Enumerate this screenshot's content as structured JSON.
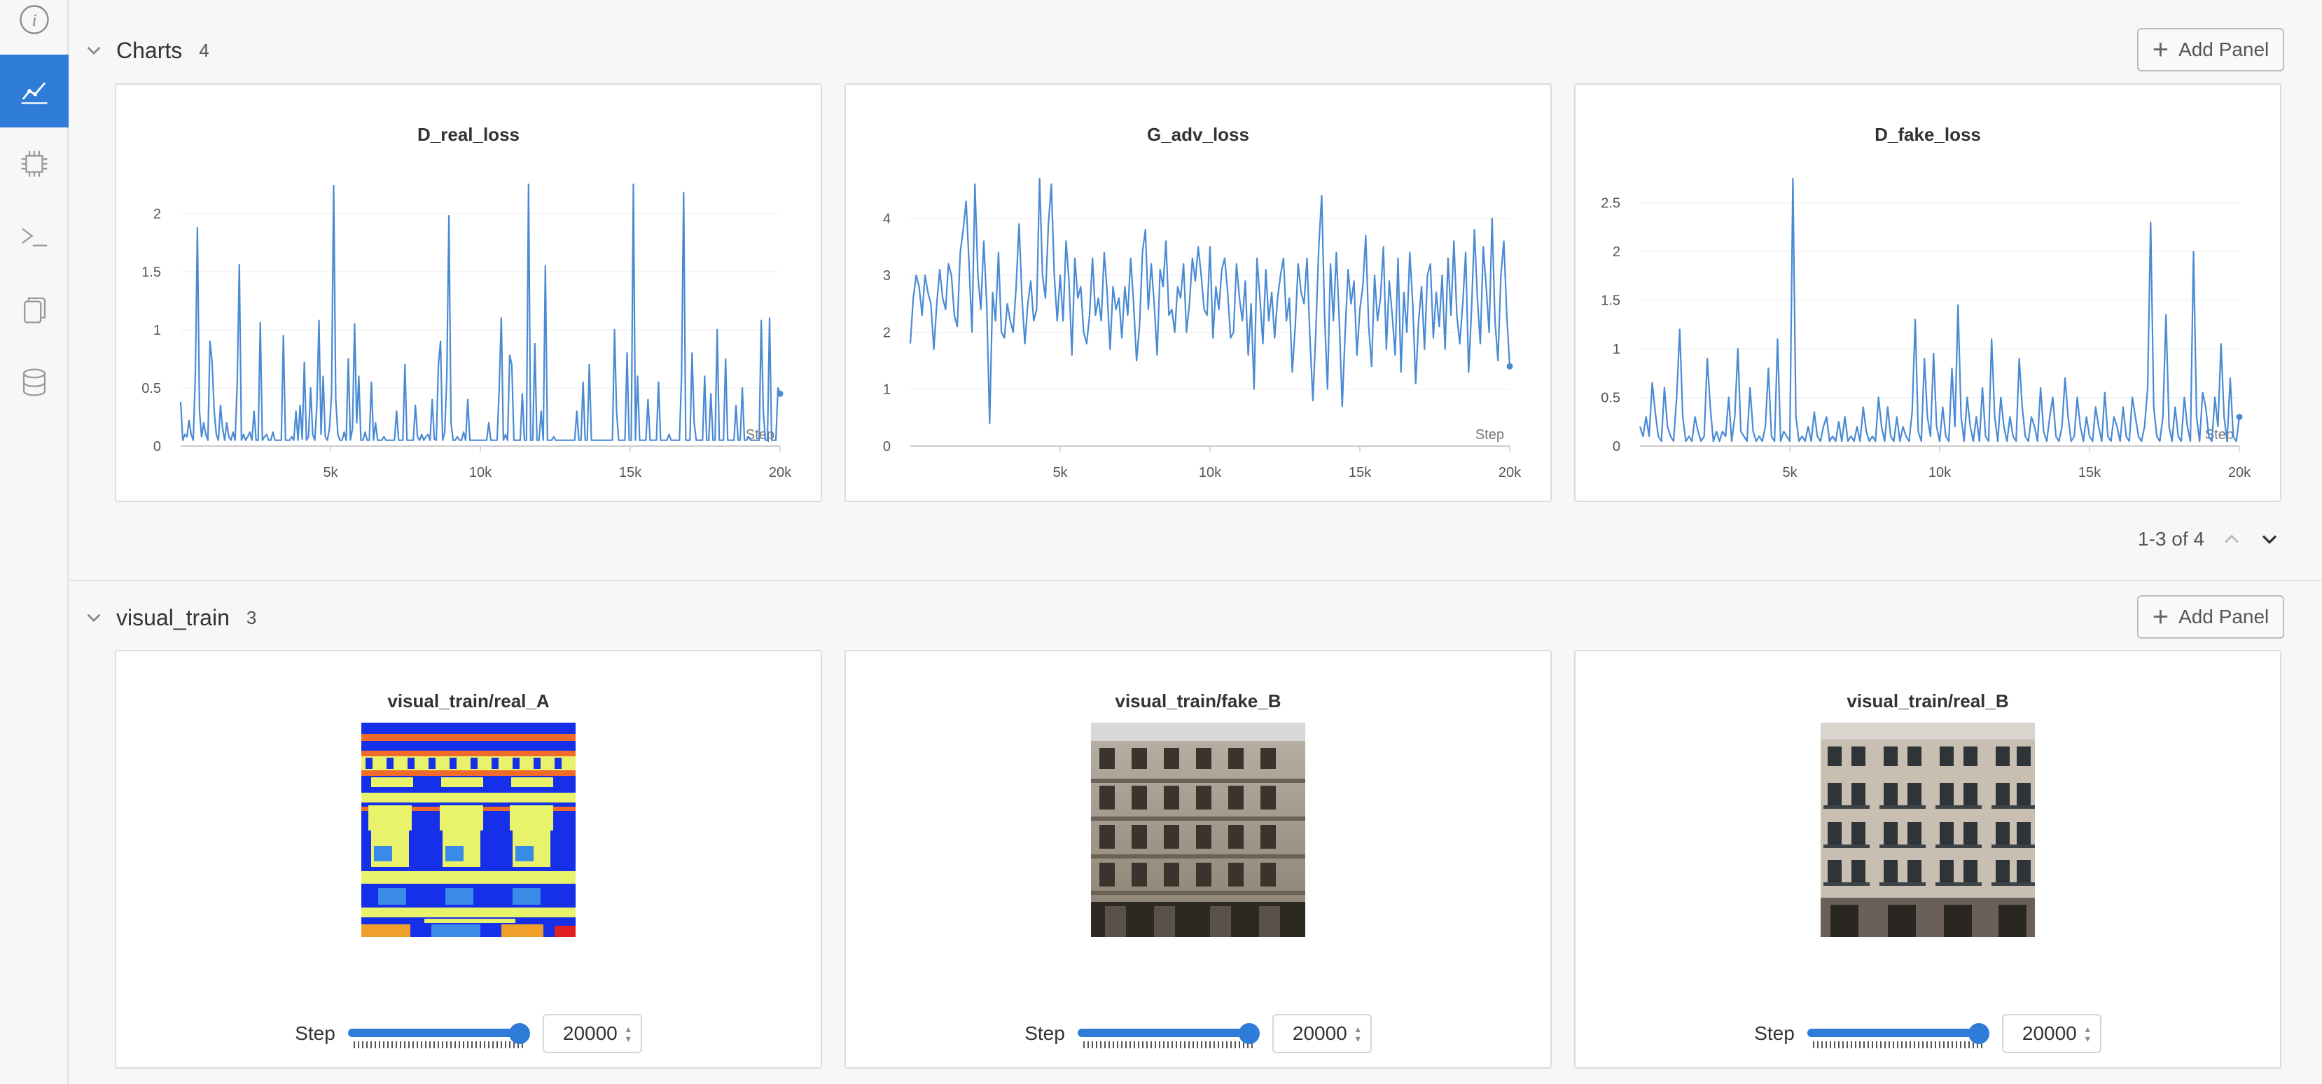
{
  "sidebar": {
    "items": [
      {
        "icon": "info-icon"
      },
      {
        "icon": "chart-icon",
        "active": true
      },
      {
        "icon": "cpu-icon"
      },
      {
        "icon": "terminal-icon"
      },
      {
        "icon": "files-icon"
      },
      {
        "icon": "database-icon"
      }
    ]
  },
  "charts_section": {
    "title": "Charts",
    "count": "4",
    "add_panel_label": "Add Panel",
    "pager_text": "1-3 of 4"
  },
  "visual_section": {
    "title": "visual_train",
    "count": "3",
    "add_panel_label": "Add Panel"
  },
  "colors": {
    "accent": "#2e7bd8",
    "line": "#4a8ad4"
  },
  "chart_data": [
    {
      "type": "line",
      "title": "D_real_loss",
      "xlabel": "Step",
      "xlim": [
        0,
        20000
      ],
      "ylim": [
        0,
        2.3
      ],
      "xticks": [
        "5k",
        "10k",
        "15k",
        "20k"
      ],
      "xtick_values": [
        5000,
        10000,
        15000,
        20000
      ],
      "yticks": [
        "0",
        "0.5",
        "1",
        "1.5",
        "2"
      ],
      "ytick_values": [
        0,
        0.5,
        1,
        1.5,
        2
      ],
      "series": [
        {
          "values": [
            0.38,
            0.05,
            0.1,
            0.08,
            0.22,
            0.1,
            0.05,
            0.62,
            1.88,
            0.3,
            0.08,
            0.2,
            0.1,
            0.05,
            0.9,
            0.72,
            0.3,
            0.1,
            0.05,
            0.35,
            0.15,
            0.05,
            0.2,
            0.08,
            0.05,
            0.12,
            0.05,
            0.55,
            1.56,
            0.05,
            0.1,
            0.05,
            0.08,
            0.12,
            0.05,
            0.3,
            0.05,
            0.05,
            1.06,
            0.05,
            0.08,
            0.1,
            0.05,
            0.05,
            0.12,
            0.05,
            0.05,
            0.05,
            0.05,
            0.95,
            0.05,
            0.05,
            0.05,
            0.08,
            0.05,
            0.3,
            0.05,
            0.35,
            0.06,
            0.72,
            0.05,
            0.08,
            0.5,
            0.1,
            0.05,
            0.35,
            1.08,
            0.1,
            0.6,
            0.08,
            0.05,
            0.15,
            0.45,
            2.24,
            0.4,
            0.1,
            0.05,
            0.05,
            0.12,
            0.05,
            0.75,
            0.05,
            0.15,
            1.05,
            0.2,
            0.6,
            0.05,
            0.05,
            0.12,
            0.05,
            0.05,
            0.55,
            0.05,
            0.2,
            0.05,
            0.05,
            0.05,
            0.08,
            0.05,
            0.05,
            0.05,
            0.05,
            0.05,
            0.3,
            0.05,
            0.05,
            0.05,
            0.7,
            0.05,
            0.05,
            0.05,
            0.05,
            0.35,
            0.08,
            0.05,
            0.1,
            0.05,
            0.08,
            0.1,
            0.05,
            0.4,
            0.06,
            0.05,
            0.7,
            0.9,
            0.05,
            0.12,
            0.6,
            1.98,
            0.2,
            0.05,
            0.05,
            0.08,
            0.05,
            0.05,
            0.12,
            0.05,
            0.4,
            0.05,
            0.05,
            0.05,
            0.05,
            0.05,
            0.05,
            0.05,
            0.05,
            0.05,
            0.2,
            0.05,
            0.05,
            0.05,
            0.05,
            0.5,
            1.1,
            0.05,
            0.1,
            0.05,
            0.78,
            0.7,
            0.05,
            0.05,
            0.05,
            0.05,
            0.45,
            0.05,
            0.05,
            2.25,
            0.05,
            0.05,
            0.88,
            0.05,
            0.05,
            0.3,
            0.05,
            1.55,
            0.05,
            0.05,
            0.05,
            0.08,
            0.05,
            0.05,
            0.05,
            0.05,
            0.05,
            0.05,
            0.05,
            0.05,
            0.05,
            0.05,
            0.3,
            0.05,
            0.05,
            0.55,
            0.05,
            0.05,
            0.7,
            0.05,
            0.05,
            0.05,
            0.05,
            0.05,
            0.05,
            0.05,
            0.05,
            0.05,
            0.05,
            0.05,
            1.0,
            0.3,
            0.05,
            0.05,
            0.05,
            0.05,
            0.8,
            0.05,
            0.05,
            2.25,
            0.05,
            0.6,
            0.05,
            0.05,
            0.05,
            0.05,
            0.4,
            0.05,
            0.05,
            0.05,
            0.05,
            0.55,
            0.05,
            0.05,
            0.05,
            0.05,
            0.1,
            0.05,
            0.05,
            0.05,
            0.05,
            0.05,
            0.6,
            2.18,
            0.05,
            0.05,
            0.05,
            0.8,
            0.2,
            0.05,
            0.05,
            0.05,
            0.05,
            0.6,
            0.05,
            0.05,
            0.45,
            0.05,
            0.05,
            1.0,
            0.05,
            0.05,
            0.05,
            0.75,
            0.05,
            0.05,
            0.05,
            0.05,
            0.35,
            0.05,
            0.05,
            0.5,
            0.05,
            0.05,
            0.08,
            0.05,
            0.05,
            0.05,
            0.05,
            0.05,
            1.08,
            0.3,
            0.05,
            0.05,
            1.1,
            0.05,
            0.05,
            0.05,
            0.5,
            0.45
          ]
        }
      ]
    },
    {
      "type": "line",
      "title": "G_adv_loss",
      "xlabel": "Step",
      "xlim": [
        0,
        20000
      ],
      "ylim": [
        0,
        4.7
      ],
      "xticks": [
        "5k",
        "10k",
        "15k",
        "20k"
      ],
      "xtick_values": [
        5000,
        10000,
        15000,
        20000
      ],
      "yticks": [
        "0",
        "1",
        "2",
        "3",
        "4"
      ],
      "ytick_values": [
        0,
        1,
        2,
        3,
        4
      ],
      "series": [
        {
          "values": [
            1.8,
            2.6,
            3.0,
            2.8,
            2.3,
            3.0,
            2.7,
            2.5,
            1.7,
            2.5,
            3.1,
            2.6,
            2.4,
            3.2,
            3.0,
            2.3,
            2.1,
            3.4,
            3.8,
            4.3,
            3.2,
            2.0,
            4.6,
            3.0,
            2.4,
            3.6,
            2.5,
            0.4,
            2.7,
            2.2,
            3.4,
            2.0,
            1.9,
            2.5,
            2.2,
            2.0,
            2.8,
            3.9,
            2.6,
            1.8,
            2.5,
            2.9,
            2.2,
            2.4,
            4.7,
            3.0,
            2.6,
            3.9,
            4.6,
            3.0,
            2.2,
            3.0,
            2.2,
            3.6,
            2.9,
            1.6,
            3.3,
            2.6,
            2.8,
            2.0,
            1.8,
            2.3,
            3.3,
            2.3,
            2.6,
            2.2,
            3.4,
            2.7,
            1.7,
            2.8,
            2.4,
            2.6,
            1.9,
            2.8,
            2.3,
            3.3,
            2.5,
            1.5,
            2.1,
            3.4,
            3.8,
            2.4,
            3.2,
            2.5,
            1.6,
            3.1,
            2.8,
            3.6,
            2.3,
            2.4,
            2.0,
            2.8,
            2.6,
            3.2,
            2.0,
            2.5,
            3.3,
            2.9,
            3.5,
            3.0,
            2.4,
            2.3,
            3.5,
            1.9,
            2.8,
            2.4,
            3.1,
            3.3,
            2.7,
            1.9,
            2.0,
            3.2,
            2.6,
            2.2,
            2.9,
            1.6,
            2.5,
            1.0,
            3.3,
            2.6,
            1.8,
            3.1,
            2.2,
            2.7,
            1.9,
            2.6,
            3.0,
            3.3,
            2.2,
            2.6,
            1.3,
            2.1,
            3.2,
            2.7,
            2.5,
            3.3,
            1.9,
            0.8,
            2.0,
            3.5,
            4.4,
            2.3,
            1.0,
            3.2,
            2.2,
            3.4,
            2.2,
            0.7,
            2.0,
            3.1,
            2.5,
            2.9,
            1.6,
            2.4,
            2.8,
            3.7,
            2.1,
            1.4,
            3.0,
            2.2,
            2.6,
            3.5,
            1.7,
            2.9,
            2.3,
            1.6,
            3.3,
            1.3,
            2.7,
            2.0,
            3.4,
            2.5,
            1.1,
            2.2,
            2.8,
            1.7,
            3.0,
            3.2,
            1.9,
            2.7,
            2.1,
            3.0,
            1.7,
            3.3,
            2.3,
            3.6,
            2.3,
            1.8,
            2.5,
            3.4,
            1.3,
            2.4,
            3.8,
            2.6,
            1.8,
            3.5,
            2.8,
            2.0,
            4.0,
            2.2,
            1.5,
            3.0,
            3.6,
            2.3,
            1.4
          ]
        }
      ]
    },
    {
      "type": "line",
      "title": "D_fake_loss",
      "xlabel": "Step",
      "xlim": [
        0,
        20000
      ],
      "ylim": [
        0,
        2.75
      ],
      "xticks": [
        "5k",
        "10k",
        "15k",
        "20k"
      ],
      "xtick_values": [
        5000,
        10000,
        15000,
        20000
      ],
      "yticks": [
        "0",
        "0.5",
        "1",
        "1.5",
        "2",
        "2.5"
      ],
      "ytick_values": [
        0,
        0.5,
        1,
        1.5,
        2,
        2.5
      ],
      "series": [
        {
          "values": [
            0.2,
            0.1,
            0.3,
            0.1,
            0.65,
            0.35,
            0.1,
            0.05,
            0.6,
            0.2,
            0.1,
            0.05,
            0.5,
            1.2,
            0.3,
            0.05,
            0.1,
            0.05,
            0.3,
            0.15,
            0.05,
            0.1,
            0.9,
            0.4,
            0.05,
            0.15,
            0.05,
            0.15,
            0.1,
            0.5,
            0.05,
            0.3,
            1.0,
            0.15,
            0.1,
            0.05,
            0.6,
            0.15,
            0.05,
            0.1,
            0.05,
            0.2,
            0.8,
            0.1,
            0.05,
            1.1,
            0.05,
            0.15,
            0.1,
            0.05,
            2.75,
            0.3,
            0.05,
            0.1,
            0.05,
            0.2,
            0.05,
            0.35,
            0.1,
            0.05,
            0.2,
            0.3,
            0.05,
            0.1,
            0.05,
            0.25,
            0.05,
            0.3,
            0.05,
            0.1,
            0.05,
            0.2,
            0.05,
            0.4,
            0.15,
            0.05,
            0.1,
            0.05,
            0.5,
            0.2,
            0.05,
            0.4,
            0.1,
            0.05,
            0.3,
            0.05,
            0.2,
            0.1,
            0.05,
            0.35,
            1.3,
            0.15,
            0.05,
            0.9,
            0.3,
            0.1,
            0.95,
            0.2,
            0.05,
            0.4,
            0.1,
            0.05,
            0.8,
            0.2,
            1.45,
            0.3,
            0.05,
            0.5,
            0.2,
            0.05,
            0.3,
            0.05,
            0.6,
            0.1,
            0.05,
            1.1,
            0.3,
            0.05,
            0.5,
            0.2,
            0.05,
            0.3,
            0.1,
            0.05,
            0.9,
            0.4,
            0.1,
            0.05,
            0.3,
            0.2,
            0.05,
            0.6,
            0.15,
            0.05,
            0.3,
            0.5,
            0.1,
            0.05,
            0.2,
            0.7,
            0.3,
            0.05,
            0.1,
            0.5,
            0.2,
            0.05,
            0.3,
            0.1,
            0.05,
            0.4,
            0.2,
            0.05,
            0.55,
            0.1,
            0.05,
            0.3,
            0.2,
            0.05,
            0.4,
            0.1,
            0.05,
            0.5,
            0.3,
            0.1,
            0.05,
            0.2,
            0.6,
            2.3,
            0.4,
            0.1,
            0.05,
            0.3,
            1.35,
            0.2,
            0.05,
            0.4,
            0.1,
            0.05,
            0.5,
            0.2,
            0.05,
            2.0,
            0.3,
            0.05,
            0.55,
            0.4,
            0.1,
            0.05,
            0.5,
            0.2,
            1.05,
            0.3,
            0.05,
            0.7,
            0.1,
            0.05,
            0.3
          ]
        }
      ]
    }
  ],
  "visual_panels": [
    {
      "title": "visual_train/real_A",
      "image": "segmentation-label-map",
      "step_label": "Step",
      "step_value": "20000"
    },
    {
      "title": "visual_train/fake_B",
      "image": "generated-building-facade",
      "step_label": "Step",
      "step_value": "20000"
    },
    {
      "title": "visual_train/real_B",
      "image": "real-building-facade",
      "step_label": "Step",
      "step_value": "20000"
    }
  ]
}
